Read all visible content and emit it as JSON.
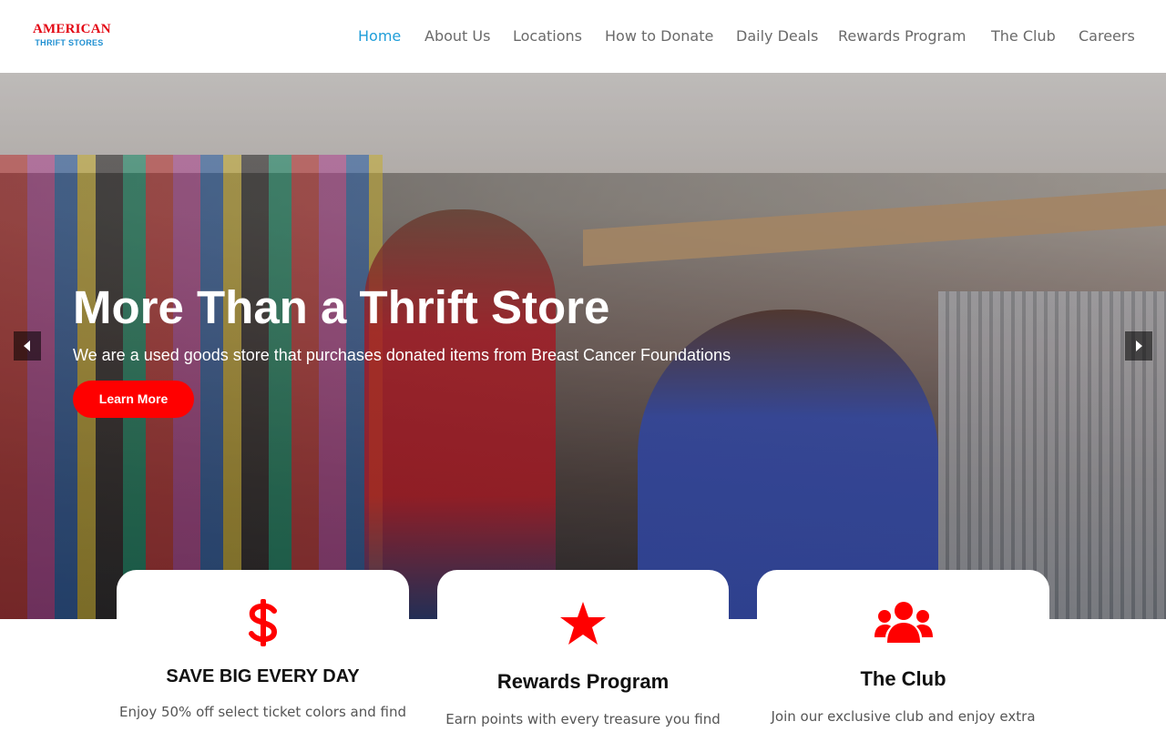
{
  "header": {
    "logo_top": "AMERICAN",
    "logo_bottom": "THRIFT STORES",
    "nav": [
      {
        "label": "Home",
        "active": true
      },
      {
        "label": "About Us"
      },
      {
        "label": "Locations"
      },
      {
        "label": "How to Donate"
      },
      {
        "label": "Daily Deals"
      },
      {
        "label": "Rewards Program"
      },
      {
        "label": "The Club"
      },
      {
        "label": "Careers"
      }
    ]
  },
  "hero": {
    "title": "More Than a Thrift Store",
    "subtitle": "We are a used goods store that purchases donated items from Breast Cancer Foundations",
    "button_label": "Learn More"
  },
  "cards": [
    {
      "icon": "dollar-icon",
      "title": "SAVE BIG EVERY DAY",
      "text": "Enjoy 50% off select ticket colors and find"
    },
    {
      "icon": "star-icon",
      "title": "Rewards Program",
      "text": "Earn points with every treasure you find"
    },
    {
      "icon": "users-icon",
      "title": "The Club",
      "text": "Join our exclusive club and enjoy extra"
    }
  ],
  "colors": {
    "brand_red": "#ff0000",
    "logo_red": "#e30613",
    "logo_blue": "#1f8fd1",
    "nav_active": "#1f9ed9",
    "nav_text": "#6a6a6a"
  }
}
